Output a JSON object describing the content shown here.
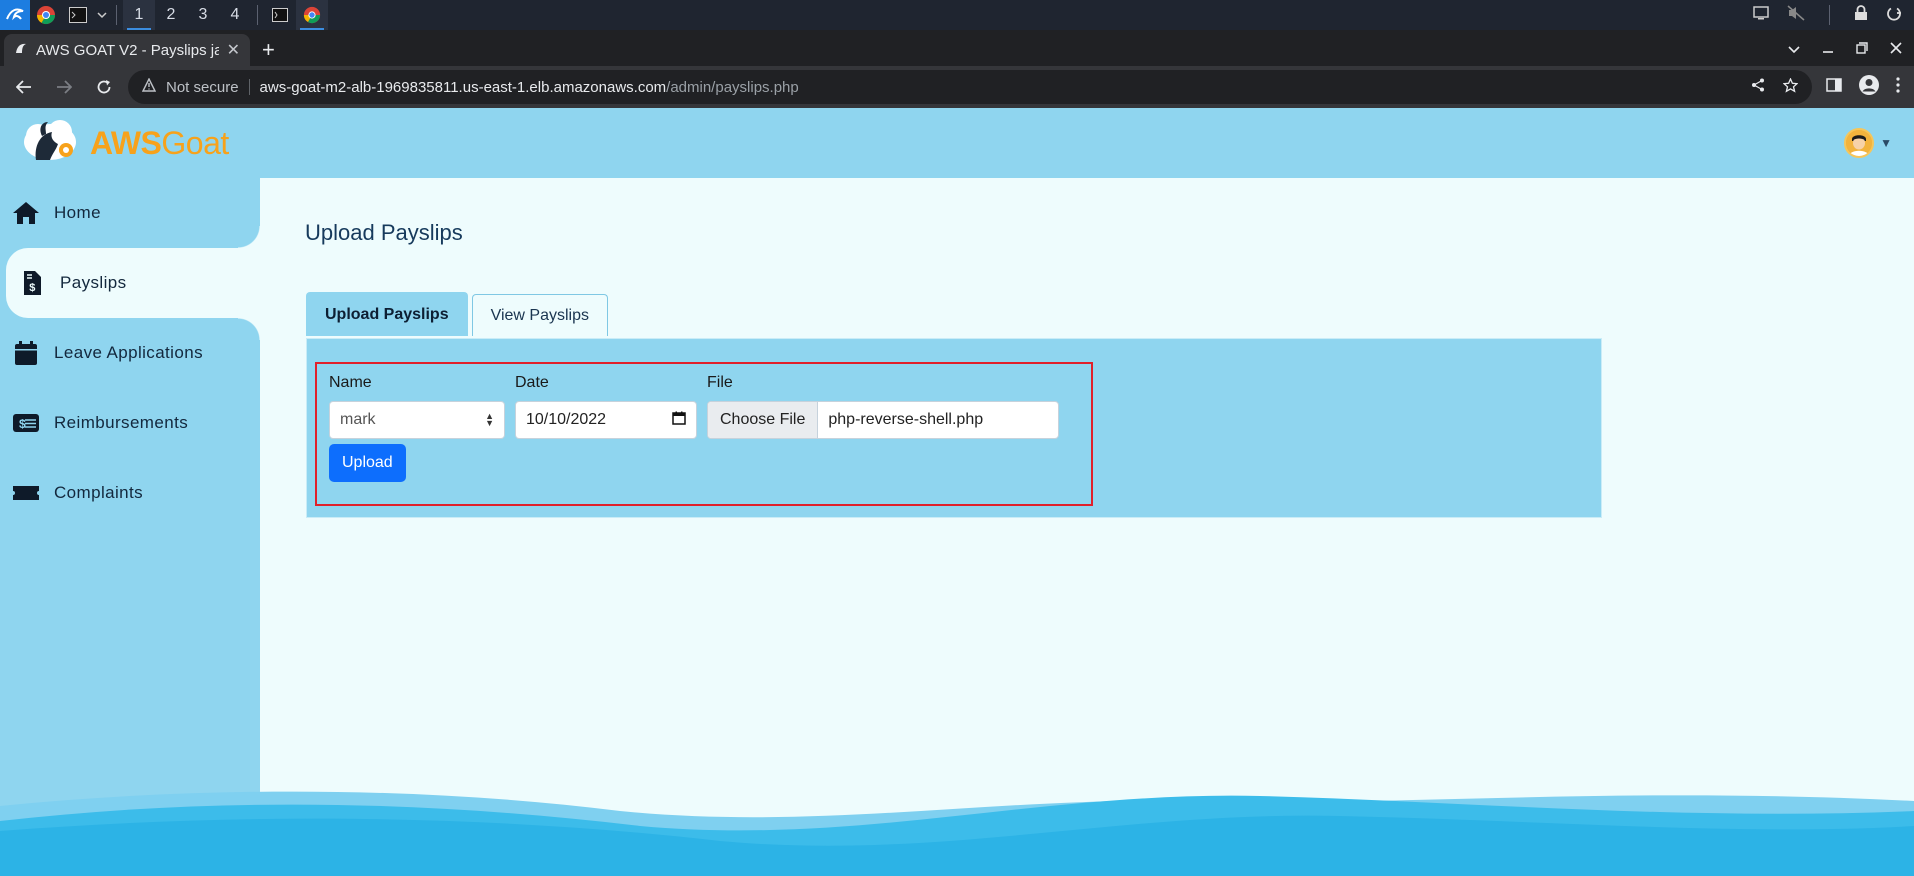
{
  "os": {
    "workspaces": [
      "1",
      "2",
      "3",
      "4"
    ],
    "active_workspace": "1"
  },
  "browser": {
    "tab_title": "AWS GOAT V2 - Payslips ja",
    "url_security": "Not secure",
    "url_host": "aws-goat-m2-alb-1969835811.us-east-1.elb.amazonaws.com",
    "url_path": "/admin/payslips.php"
  },
  "app": {
    "logo_aws": "AWS",
    "logo_goat": "Goat"
  },
  "sidebar": {
    "items": [
      {
        "label": "Home",
        "icon": "home-icon"
      },
      {
        "label": "Payslips",
        "icon": "payslip-icon",
        "active": true
      },
      {
        "label": "Leave Applications",
        "icon": "calendar-icon"
      },
      {
        "label": "Reimbursements",
        "icon": "money-card-icon"
      },
      {
        "label": "Complaints",
        "icon": "ticket-icon"
      }
    ]
  },
  "main": {
    "title": "Upload Payslips",
    "tabs": [
      {
        "label": "Upload Payslips",
        "active": true
      },
      {
        "label": "View Payslips",
        "active": false
      }
    ],
    "form": {
      "name_label": "Name",
      "name_value": "mark",
      "date_label": "Date",
      "date_value": "10/10/2022",
      "file_label": "File",
      "file_button": "Choose File",
      "file_name": "php-reverse-shell.php",
      "submit_label": "Upload"
    }
  },
  "colors": {
    "header_bg": "#8fd5ef",
    "content_bg": "#eefcfd",
    "accent_orange": "#f7a21b",
    "primary_button": "#0d6efd",
    "highlight_box": "#e0202a"
  }
}
